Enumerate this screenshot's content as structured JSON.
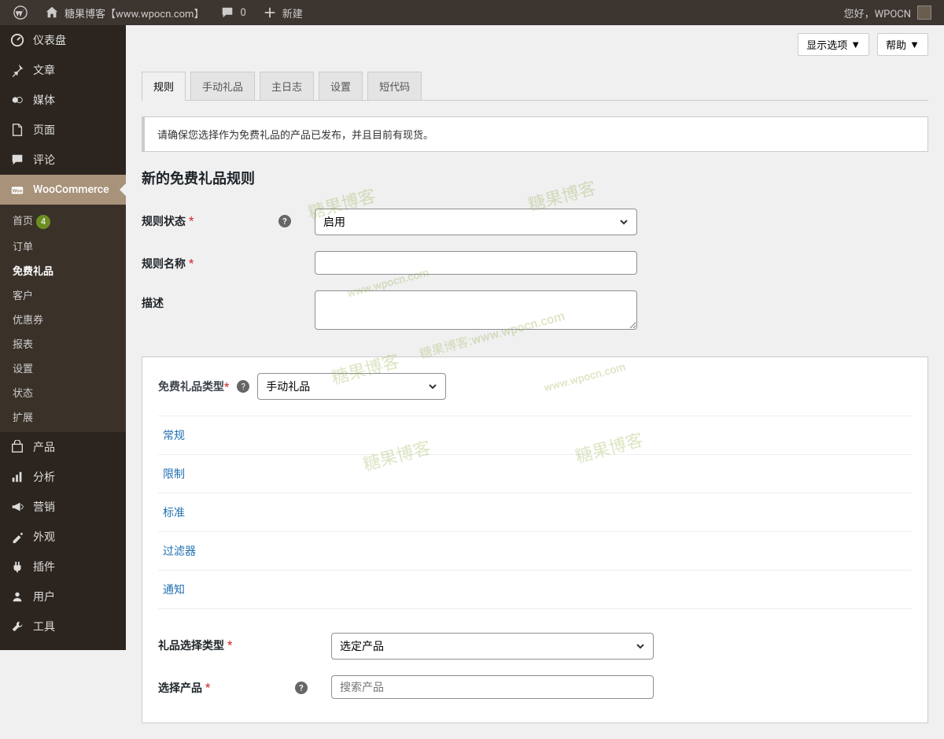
{
  "adminbar": {
    "site_title": "糖果博客【www.wpocn.com】",
    "comments_count": "0",
    "new_label": "新建",
    "greeting": "您好，WPOCN"
  },
  "sidebar": {
    "items": [
      {
        "label": "仪表盘",
        "icon": "dashboard"
      },
      {
        "label": "文章",
        "icon": "pin"
      },
      {
        "label": "媒体",
        "icon": "media"
      },
      {
        "label": "页面",
        "icon": "page"
      },
      {
        "label": "评论",
        "icon": "comment"
      },
      {
        "label": "WooCommerce",
        "icon": "woo",
        "active": true
      },
      {
        "label": "产品",
        "icon": "product"
      },
      {
        "label": "分析",
        "icon": "analytics"
      },
      {
        "label": "营销",
        "icon": "marketing"
      },
      {
        "label": "外观",
        "icon": "appearance"
      },
      {
        "label": "插件",
        "icon": "plugins"
      },
      {
        "label": "用户",
        "icon": "users"
      },
      {
        "label": "工具",
        "icon": "tools"
      }
    ],
    "woo_sub": [
      {
        "label": "首页",
        "badge": "4"
      },
      {
        "label": "订单"
      },
      {
        "label": "免费礼品",
        "current": true
      },
      {
        "label": "客户"
      },
      {
        "label": "优惠券"
      },
      {
        "label": "报表"
      },
      {
        "label": "设置"
      },
      {
        "label": "状态"
      },
      {
        "label": "扩展"
      }
    ]
  },
  "header": {
    "screen_options": "显示选项",
    "help": "帮助"
  },
  "tabs": [
    {
      "label": "规则",
      "active": true
    },
    {
      "label": "手动礼品"
    },
    {
      "label": "主日志"
    },
    {
      "label": "设置"
    },
    {
      "label": "短代码"
    }
  ],
  "notice": "请确保您选择作为免费礼品的产品已发布，并且目前有现货。",
  "page_title": "新的免费礼品规则",
  "form": {
    "rule_status": {
      "label": "规则状态",
      "value": "启用"
    },
    "rule_name": {
      "label": "规则名称",
      "value": ""
    },
    "description": {
      "label": "描述",
      "value": ""
    },
    "gift_type": {
      "label": "免费礼品类型",
      "value": "手动礼品"
    },
    "gift_select_type": {
      "label": "礼品选择类型",
      "value": "选定产品"
    },
    "select_product": {
      "label": "选择产品",
      "placeholder": "搜索产品"
    }
  },
  "subnav": [
    "常规",
    "限制",
    "标准",
    "过滤器",
    "通知"
  ],
  "watermarks": [
    "糖果博客",
    "www.wpocn.com",
    "糖果博客:www.wpocn.com"
  ]
}
